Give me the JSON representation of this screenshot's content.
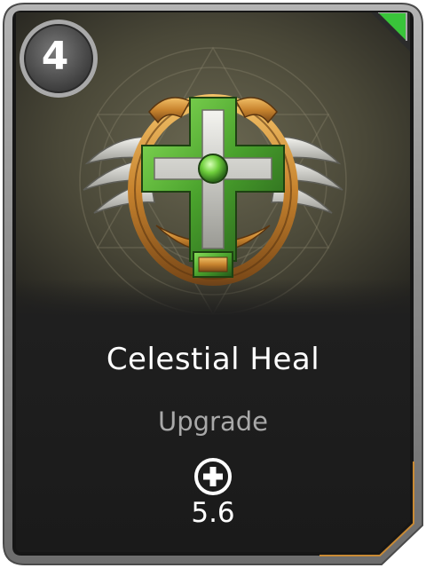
{
  "card": {
    "cost": "4",
    "title": "Celestial Heal",
    "stat_label": "Upgrade",
    "stat_value": "5.6",
    "stat_icon": "health-plus-icon",
    "art_icon": "winged-cross-emblem-icon",
    "corner_flag_icon": "upgrade-flag-icon"
  },
  "colors": {
    "frame_outer": "#9a9a9a",
    "frame_inner": "#1c1c1c",
    "panel": "#1f1f1f",
    "art_bg": "#4c4a3a",
    "accent_green": "#39c43a",
    "emblem_gold": "#c98a34",
    "emblem_green": "#4c9f2e"
  }
}
